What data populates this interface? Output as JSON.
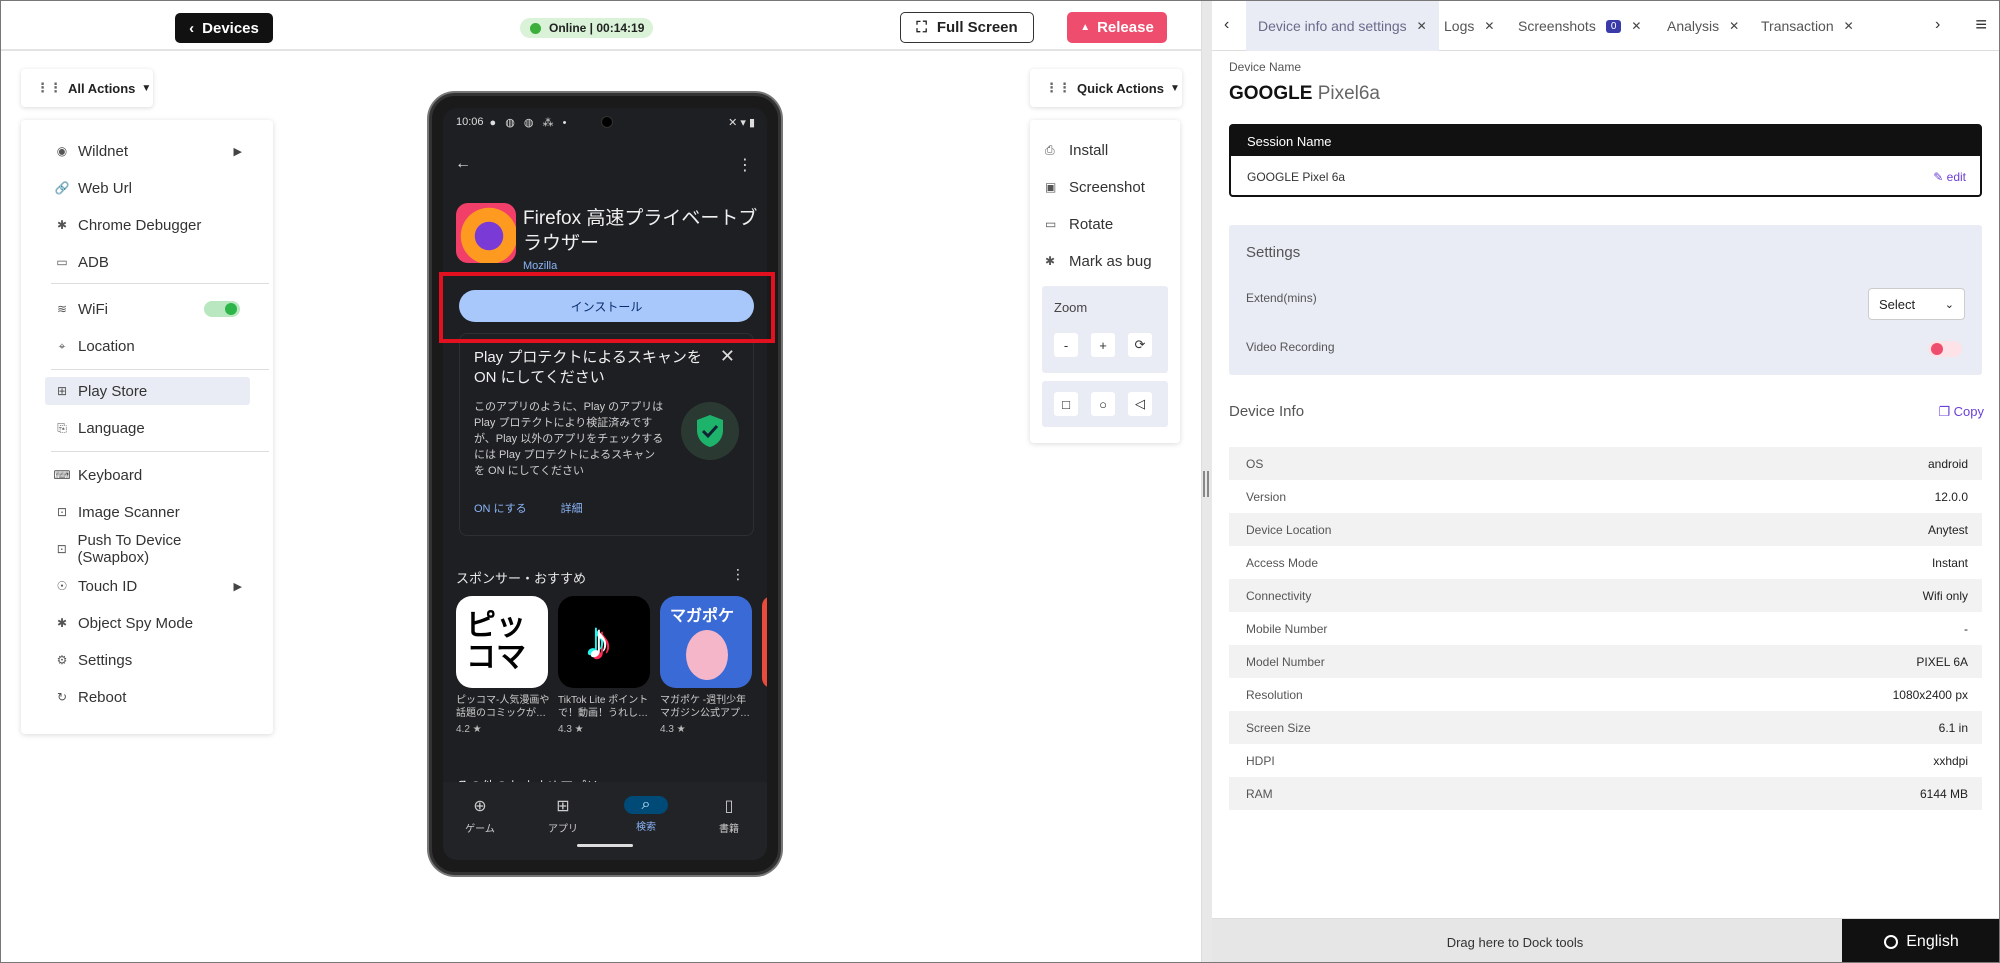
{
  "topbar": {
    "devices_label": "Devices",
    "status_text": "Online | 00:14:19",
    "fullscreen_label": "Full Screen",
    "release_label": "Release"
  },
  "all_actions": {
    "label": "All Actions",
    "items": [
      {
        "label": "Wildnet",
        "icon": "wifi-signal-icon",
        "has_submenu": true
      },
      {
        "label": "Web Url",
        "icon": "link-icon"
      },
      {
        "label": "Chrome Debugger",
        "icon": "bug-icon"
      },
      {
        "label": "ADB",
        "icon": "terminal-icon"
      },
      {
        "label": "WiFi",
        "icon": "wifi-icon",
        "toggle": "on"
      },
      {
        "label": "Location",
        "icon": "location-pin-icon"
      },
      {
        "label": "Play Store",
        "icon": "grid-plus-icon",
        "active": true
      },
      {
        "label": "Language",
        "icon": "translate-icon"
      },
      {
        "label": "Keyboard",
        "icon": "keyboard-icon"
      },
      {
        "label": "Image Scanner",
        "icon": "scanner-icon"
      },
      {
        "label": "Push To Device (Swapbox)",
        "icon": "push-icon"
      },
      {
        "label": "Touch ID",
        "icon": "fingerprint-icon",
        "has_submenu": true
      },
      {
        "label": "Object Spy Mode",
        "icon": "spy-icon"
      },
      {
        "label": "Settings",
        "icon": "gear-icon"
      },
      {
        "label": "Reboot",
        "icon": "reboot-icon"
      }
    ]
  },
  "phone": {
    "time": "10:06",
    "app_title": "Firefox 高速プライベートブラウザー",
    "developer": "Mozilla",
    "install_label": "インストール",
    "protect_title": "Play プロテクトによるスキャンを ON にしてください",
    "protect_body": "このアプリのように、Play のアプリは Play プロテクトにより検証済みですが、Play 以外のアプリをチェックするには Play プロテクトによるスキャンを ON にしてください",
    "protect_on": "ON にする",
    "protect_details": "詳細",
    "sponsor_title": "スポンサー・おすすめ",
    "apps": [
      {
        "name": "ピッコマ-人気漫画や話題のコミックが…",
        "rating": "4.2 ★",
        "color": "#ffffff"
      },
      {
        "name": "TikTok Lite ポイントで！動画！うれし…",
        "rating": "4.3 ★",
        "color": "#000000"
      },
      {
        "name": "マガポケ -週刊少年マガジン公式アプ…",
        "rating": "4.3 ★",
        "color": "#3a6ad6"
      }
    ],
    "more_apps": "その他のおすすめアプリ",
    "nav": [
      {
        "label": "ゲーム",
        "icon": "gamepad-icon"
      },
      {
        "label": "アプリ",
        "icon": "apps-grid-icon"
      },
      {
        "label": "検索",
        "icon": "search-icon",
        "selected": true
      },
      {
        "label": "書籍",
        "icon": "book-icon"
      }
    ]
  },
  "quick_actions": {
    "label": "Quick Actions",
    "items": [
      {
        "label": "Install",
        "icon": "install-icon"
      },
      {
        "label": "Screenshot",
        "icon": "screenshot-icon"
      },
      {
        "label": "Rotate",
        "icon": "rotate-icon"
      },
      {
        "label": "Mark as bug",
        "icon": "bug-icon"
      }
    ],
    "zoom_label": "Zoom",
    "zoom_out": "-",
    "zoom_in": "+",
    "zoom_reset": "⟳"
  },
  "tabs": [
    {
      "label": "Device info and settings",
      "active": true
    },
    {
      "label": "Logs"
    },
    {
      "label": "Screenshots",
      "badge": "0"
    },
    {
      "label": "Analysis"
    },
    {
      "label": "Transaction"
    }
  ],
  "device": {
    "name_label": "Device Name",
    "brand": "GOOGLE",
    "model": "Pixel6a",
    "session_label": "Session Name",
    "session_value": "GOOGLE Pixel 6a",
    "edit_label": "edit"
  },
  "settings": {
    "title": "Settings",
    "extend_label": "Extend(mins)",
    "extend_value": "Select",
    "video_label": "Video Recording",
    "video_enabled": false
  },
  "device_info": {
    "title": "Device Info",
    "copy_label": "Copy",
    "rows": [
      {
        "k": "OS",
        "v": "android"
      },
      {
        "k": "Version",
        "v": "12.0.0"
      },
      {
        "k": "Device Location",
        "v": "Anytest"
      },
      {
        "k": "Access Mode",
        "v": "Instant"
      },
      {
        "k": "Connectivity",
        "v": "Wifi only"
      },
      {
        "k": "Mobile Number",
        "v": "-"
      },
      {
        "k": "Model Number",
        "v": "PIXEL 6A"
      },
      {
        "k": "Resolution",
        "v": "1080x2400 px"
      },
      {
        "k": "Screen Size",
        "v": "6.1 in"
      },
      {
        "k": "HDPI",
        "v": "xxhdpi"
      },
      {
        "k": "RAM",
        "v": "6144 MB"
      }
    ]
  },
  "dock": {
    "text": "Drag here to Dock tools",
    "language": "English"
  }
}
